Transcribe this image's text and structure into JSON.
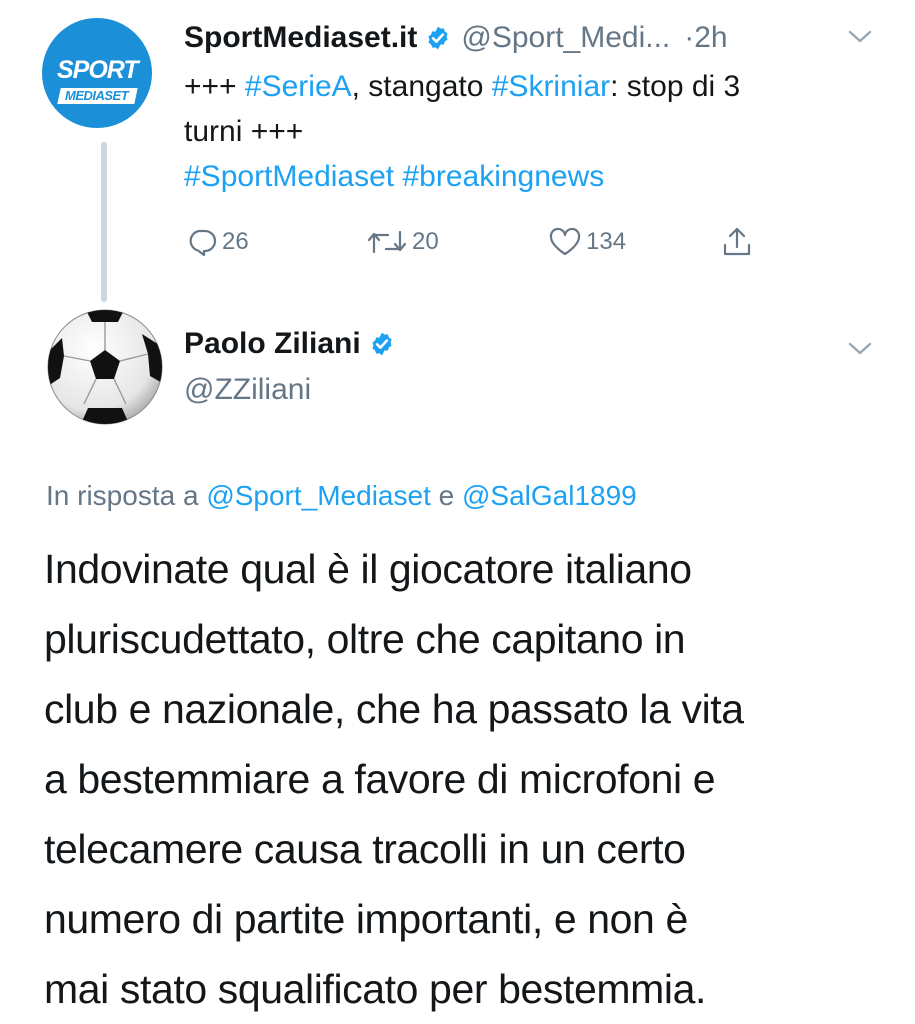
{
  "tweet1": {
    "display_name": "SportMediaset.it",
    "handle": "@Sport_Medi...",
    "time": "·2h",
    "avatar": {
      "line1": "SPORT",
      "line2": "MEDIASET",
      "bg_color": "#1b8fd8"
    },
    "text": {
      "prefix": "+++ ",
      "hashtag1": "#SerieA",
      "middle": ", stangato ",
      "hashtag2": "#Skriniar",
      "suffix": ": stop di 3",
      "line2": "turni +++",
      "hashtag3": "#SportMediaset",
      "hashtag4": "#breakingnews"
    },
    "actions": {
      "replies": "26",
      "retweets": "20",
      "likes": "134"
    }
  },
  "tweet2": {
    "display_name": "Paolo Ziliani",
    "handle": "@ZZiliani",
    "reply_to": {
      "prefix": "In risposta a",
      "mention1": "@Sport_Mediaset",
      "conj": "e",
      "mention2": "@SalGal1899"
    },
    "body_lines": [
      "Indovinate qual è il giocatore italiano",
      "pluriscudettato, oltre che capitano in",
      "club e nazionale, che ha passato la vita",
      "a bestemmiare a favore di microfoni e",
      "telecamere causa tracolli in un certo",
      "numero di partite importanti, e non è",
      "mai stato squalificato per bestemmia."
    ]
  },
  "icons": {
    "verified": "verified-badge-icon",
    "caret": "chevron-down-icon",
    "reply": "reply-icon",
    "retweet": "retweet-icon",
    "like": "heart-icon",
    "share": "share-icon"
  },
  "colors": {
    "link": "#1da1f2",
    "muted": "#657786",
    "text": "#14171a",
    "thread_line": "#ccd6dd"
  }
}
